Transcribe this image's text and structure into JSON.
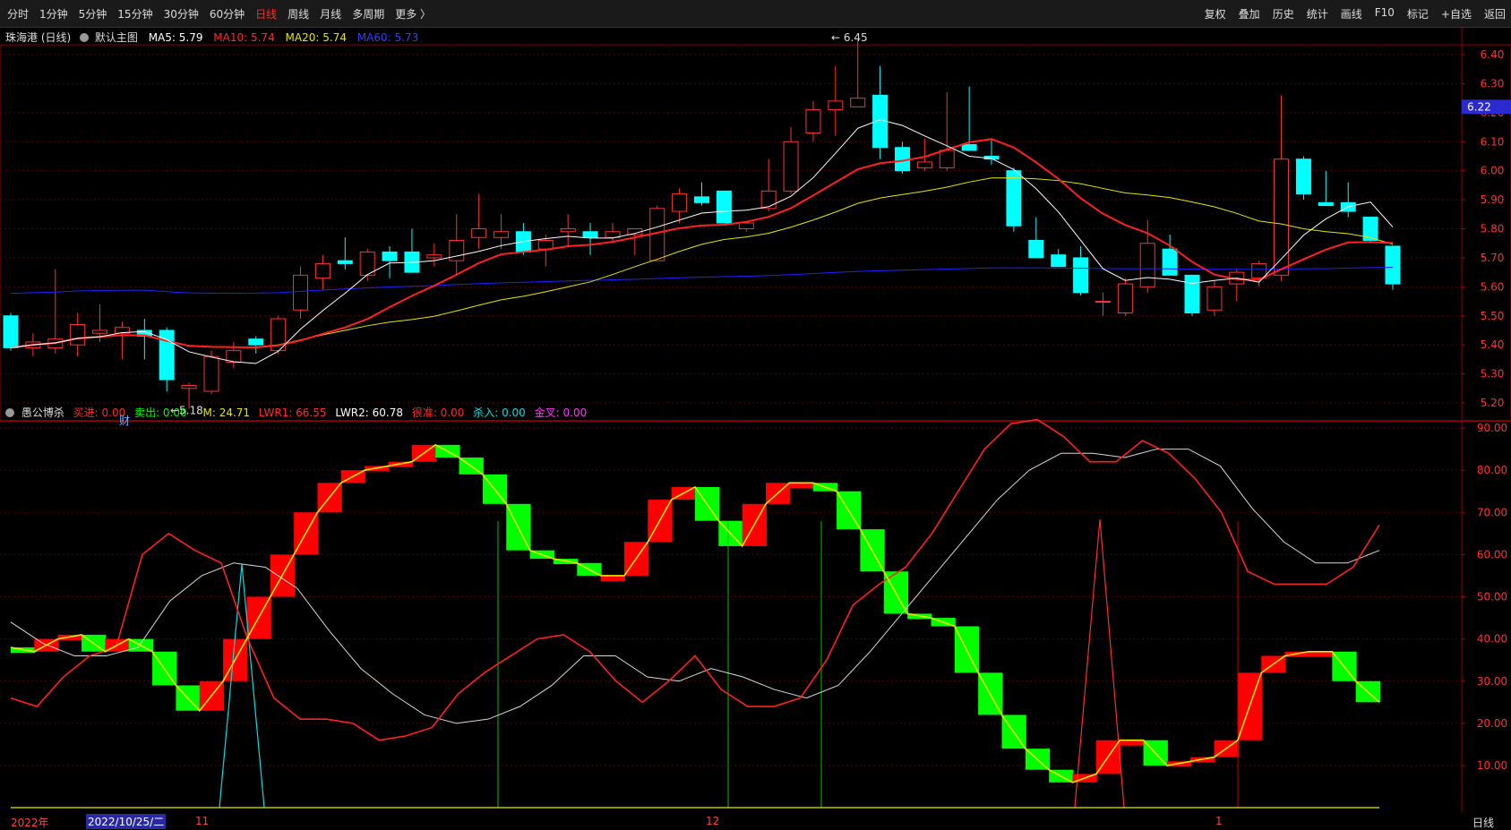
{
  "toolbar": {
    "periods": [
      "分时",
      "1分钟",
      "5分钟",
      "15分钟",
      "30分钟",
      "60分钟",
      "日线",
      "周线",
      "月线",
      "多周期",
      "更多 〉"
    ],
    "active_period": "日线",
    "tools": [
      "复权",
      "叠加",
      "历史",
      "统计",
      "画线",
      "F10",
      "标记",
      "+自选",
      "返回"
    ]
  },
  "main_header": {
    "stock": "珠海港 (日线)",
    "template": "默认主图",
    "ma5": "MA5: 5.79",
    "ma10": "MA10: 5.74",
    "ma20": "MA20: 5.74",
    "ma60": "MA60: 5.73"
  },
  "indicator_header": {
    "name": "愚公博杀",
    "buy_in": "买进: 0.00",
    "sell_out": "卖出: 0.00",
    "m": "M: 24.71",
    "lwr1": "LWR1: 66.55",
    "lwr2": "LWR2: 60.78",
    "precise": "很准: 0.00",
    "kill_in": "杀入: 0.00",
    "golden_cross": "金叉: 0.00"
  },
  "price_axis": [
    "6.40",
    "6.30",
    "6.20",
    "6.10",
    "6.00",
    "5.90",
    "5.80",
    "5.70",
    "5.60",
    "5.50",
    "5.40",
    "5.30",
    "5.20"
  ],
  "current_price": "6.22",
  "indicator_axis": [
    "90.00",
    "80.00",
    "70.00",
    "60.00",
    "50.00",
    "40.00",
    "30.00",
    "20.00",
    "10.00"
  ],
  "annotations": {
    "high": "6.45",
    "low": "5.18",
    "finance_marker": "财"
  },
  "date_axis": {
    "year": "2022年",
    "cursor_date": "2022/10/25/二",
    "months": [
      "11",
      "12",
      "1"
    ],
    "period_label": "日线"
  },
  "colors": {
    "up": "#ff3030",
    "down": "#00ffff",
    "ma5": "#ffffff",
    "ma10": "#ff2020",
    "ma20": "#e6e600",
    "ma60": "#2020ff",
    "buy": "#ff0000",
    "sell": "#00ff00"
  },
  "chart_data": {
    "type": "candlestick",
    "candles": [
      [
        5.5,
        5.51,
        5.38,
        5.39
      ],
      [
        5.39,
        5.44,
        5.36,
        5.41
      ],
      [
        5.39,
        5.66,
        5.37,
        5.42
      ],
      [
        5.4,
        5.51,
        5.36,
        5.47
      ],
      [
        5.44,
        5.54,
        5.41,
        5.45
      ],
      [
        5.44,
        5.48,
        5.35,
        5.46
      ],
      [
        5.45,
        5.49,
        5.35,
        5.43
      ],
      [
        5.45,
        5.46,
        5.24,
        5.28
      ],
      [
        5.25,
        5.27,
        5.18,
        5.26
      ],
      [
        5.24,
        5.38,
        5.23,
        5.36
      ],
      [
        5.34,
        5.41,
        5.32,
        5.38
      ],
      [
        5.42,
        5.43,
        5.37,
        5.4
      ],
      [
        5.38,
        5.5,
        5.37,
        5.49
      ],
      [
        5.52,
        5.67,
        5.49,
        5.64
      ],
      [
        5.63,
        5.71,
        5.59,
        5.68
      ],
      [
        5.69,
        5.77,
        5.66,
        5.68
      ],
      [
        5.64,
        5.73,
        5.62,
        5.72
      ],
      [
        5.72,
        5.74,
        5.63,
        5.69
      ],
      [
        5.72,
        5.8,
        5.72,
        5.65
      ],
      [
        5.7,
        5.75,
        5.67,
        5.71
      ],
      [
        5.69,
        5.85,
        5.64,
        5.76
      ],
      [
        5.77,
        5.92,
        5.73,
        5.8
      ],
      [
        5.77,
        5.85,
        5.73,
        5.79
      ],
      [
        5.79,
        5.82,
        5.71,
        5.72
      ],
      [
        5.73,
        5.78,
        5.67,
        5.76
      ],
      [
        5.79,
        5.85,
        5.74,
        5.8
      ],
      [
        5.79,
        5.82,
        5.71,
        5.77
      ],
      [
        5.77,
        5.82,
        5.75,
        5.79
      ],
      [
        5.78,
        5.8,
        5.71,
        5.8
      ],
      [
        5.69,
        5.88,
        5.69,
        5.87
      ],
      [
        5.86,
        5.94,
        5.82,
        5.92
      ],
      [
        5.91,
        5.96,
        5.88,
        5.89
      ],
      [
        5.93,
        5.93,
        5.82,
        5.82
      ],
      [
        5.8,
        5.82,
        5.79,
        5.82
      ],
      [
        5.87,
        6.04,
        5.86,
        5.93
      ],
      [
        5.93,
        6.15,
        5.92,
        6.1
      ],
      [
        6.13,
        6.24,
        6.1,
        6.21
      ],
      [
        6.21,
        6.36,
        6.12,
        6.24
      ],
      [
        6.22,
        6.45,
        6.22,
        6.25
      ],
      [
        6.26,
        6.36,
        6.04,
        6.08
      ],
      [
        6.08,
        6.1,
        5.99,
        6.0
      ],
      [
        6.01,
        6.11,
        6.0,
        6.03
      ],
      [
        6.01,
        6.27,
        6.0,
        6.07
      ],
      [
        6.09,
        6.29,
        6.08,
        6.07
      ],
      [
        6.05,
        6.11,
        6.02,
        6.04
      ],
      [
        6.0,
        6.01,
        5.79,
        5.81
      ],
      [
        5.76,
        5.84,
        5.7,
        5.7
      ],
      [
        5.71,
        5.73,
        5.67,
        5.67
      ],
      [
        5.7,
        5.74,
        5.57,
        5.58
      ],
      [
        5.55,
        5.58,
        5.5,
        5.55
      ],
      [
        5.51,
        5.63,
        5.5,
        5.61
      ],
      [
        5.6,
        5.83,
        5.58,
        5.75
      ],
      [
        5.73,
        5.78,
        5.64,
        5.64
      ],
      [
        5.64,
        5.64,
        5.5,
        5.51
      ],
      [
        5.52,
        5.62,
        5.5,
        5.6
      ],
      [
        5.61,
        5.66,
        5.55,
        5.65
      ],
      [
        5.63,
        5.69,
        5.6,
        5.68
      ],
      [
        5.64,
        6.26,
        5.62,
        6.04
      ],
      [
        6.04,
        6.05,
        5.9,
        5.92
      ],
      [
        5.89,
        6.0,
        5.88,
        5.88
      ],
      [
        5.89,
        5.96,
        5.84,
        5.86
      ],
      [
        5.84,
        5.84,
        5.75,
        5.76
      ],
      [
        5.74,
        5.74,
        5.59,
        5.61
      ]
    ],
    "indicator": {
      "M": [
        38,
        37,
        40,
        41,
        37,
        40,
        37,
        29,
        23,
        30,
        40,
        50,
        60,
        70,
        77,
        80,
        81,
        82,
        86,
        83,
        79,
        72,
        61,
        59,
        58,
        55,
        55,
        63,
        73,
        76,
        68,
        62,
        72,
        77,
        77,
        75,
        66,
        56,
        46,
        45,
        43,
        32,
        22,
        14,
        9,
        6,
        8,
        16,
        16,
        10,
        11,
        12,
        16,
        32,
        36,
        37,
        37,
        30,
        25
      ],
      "LWR1": [
        26,
        24,
        31,
        36,
        38,
        60,
        65,
        61,
        58,
        40,
        26,
        21,
        21,
        20,
        16,
        17,
        19,
        27,
        32,
        36,
        40,
        41,
        37,
        30,
        25,
        30,
        36,
        28,
        24,
        24,
        26,
        35,
        48,
        53,
        57,
        65,
        75,
        85,
        91,
        92,
        88,
        82,
        82,
        87,
        84,
        78,
        70,
        56,
        53,
        53,
        53,
        57,
        67
      ],
      "LWR2": [
        44,
        39,
        36,
        36,
        38,
        49,
        55,
        58,
        57,
        52,
        42,
        33,
        27,
        22,
        20,
        21,
        24,
        29,
        36,
        36,
        31,
        30,
        33,
        31,
        28,
        26,
        29,
        37,
        46,
        55,
        64,
        73,
        80,
        84,
        84,
        83,
        85,
        85,
        81,
        71,
        63,
        58,
        58,
        61
      ]
    }
  }
}
